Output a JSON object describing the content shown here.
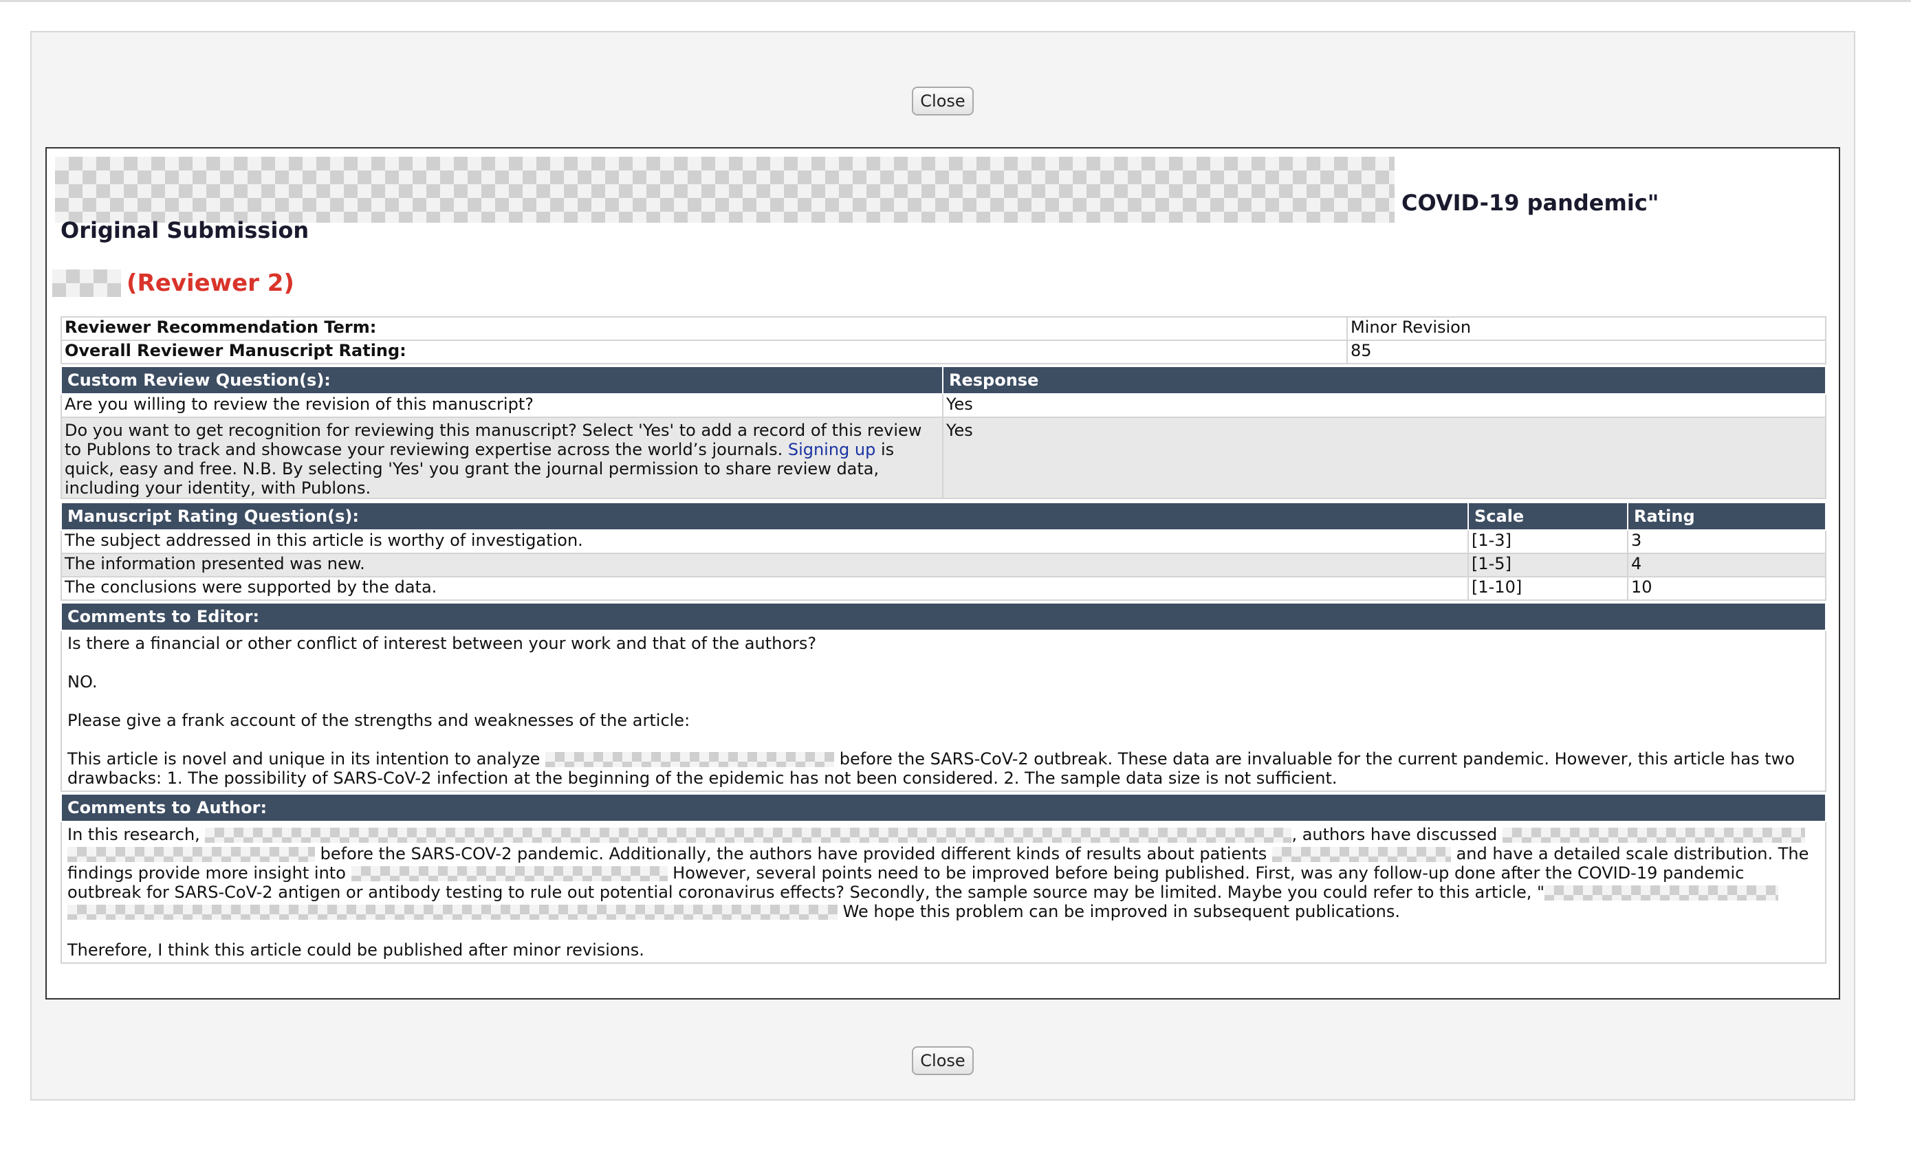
{
  "buttons": {
    "close_top": "Close",
    "close_bottom": "Close"
  },
  "header": {
    "title_visible": "COVID-19 pandemic\"",
    "subtitle": "Original Submission",
    "reviewer": "(Reviewer 2)"
  },
  "summary": [
    {
      "label": "Reviewer Recommendation Term:",
      "value": "Minor Revision"
    },
    {
      "label": "Overall Reviewer Manuscript Rating:",
      "value": "85"
    }
  ],
  "custom_questions": {
    "header_question": "Custom Review Question(s):",
    "header_response": "Response",
    "rows": [
      {
        "question": "Are you willing to review the revision of this manuscript?",
        "response": "Yes"
      },
      {
        "question_part1": "Do you want to get recognition for reviewing this manuscript? Select 'Yes' to add a record of this review to Publons to track and showcase your reviewing expertise across the world’s journals. ",
        "link": "Signing up",
        "question_part2": " is quick, easy and free. N.B. By selecting 'Yes' you grant the journal permission to share review data, including your identity, with Publons.",
        "response": "Yes"
      }
    ]
  },
  "rating_questions": {
    "header_question": "Manuscript Rating Question(s):",
    "header_scale": "Scale",
    "header_rating": "Rating",
    "rows": [
      {
        "question": "The subject addressed in this article is worthy of investigation.",
        "scale": "[1-3]",
        "rating": "3"
      },
      {
        "question": "The information presented was new.",
        "scale": "[1-5]",
        "rating": "4"
      },
      {
        "question": "The conclusions were supported by the data.",
        "scale": "[1-10]",
        "rating": "10"
      }
    ]
  },
  "comments_editor": {
    "header": "Comments to Editor:",
    "p1": "Is there a financial or other conflict of interest between your work and that of the authors?",
    "p2": "NO.",
    "p3": "Please give a frank account of the strengths and weaknesses of the article:",
    "p4a": "This article is novel and unique in its intention to analyze",
    "p4b": "before the SARS-CoV-2 outbreak. These data are invaluable for the current pandemic. However, this article has two drawbacks: 1. The possibility of SARS-CoV-2 infection at the beginning of the epidemic has not been considered. 2. The sample data size is not sufficient."
  },
  "comments_author": {
    "header": "Comments to Author:",
    "s1": "In this research,",
    "s2": ", authors have discussed",
    "s3": "before the SARS-COV-2 pandemic. Additionally, the authors have provided different kinds of results about patients",
    "s4": "and have a detailed scale distribution. The findings provide more insight into",
    "s5": "However, several points need to be improved before being published. First, was any follow-up done after the COVID-19 pandemic outbreak for SARS-CoV-2 antigen or antibody testing to rule out potential coronavirus effects? Secondly, the sample source may be limited. Maybe you could refer to this article, \"",
    "s6": "We hope this problem can be improved in subsequent publications.",
    "closing": "Therefore, I think this article could be published after minor revisions."
  }
}
